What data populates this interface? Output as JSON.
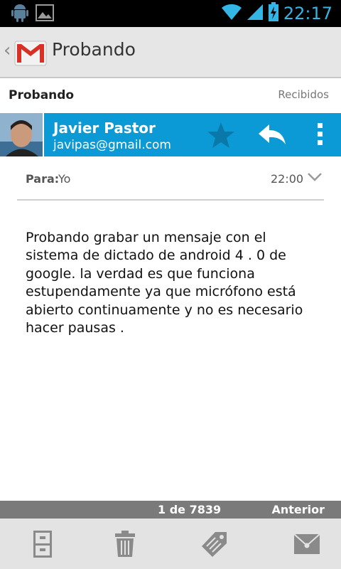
{
  "status_bar": {
    "left_icons": [
      "android-icon",
      "image-icon"
    ],
    "right_icons": [
      "wifi-icon",
      "signal-icon",
      "battery-charging-icon"
    ],
    "time": "22:17",
    "accent_color": "#33b5e5"
  },
  "action_bar": {
    "title": "Probando",
    "app_icon": "gmail-icon",
    "up_glyph": "‹"
  },
  "message": {
    "subject": "Probando",
    "folder": "Recibidos",
    "sender": {
      "name": "Javier Pastor",
      "email": "javipas@gmail.com",
      "header_color": "#0c9ad6"
    },
    "to_label": "Para:",
    "to_value": "Yo",
    "time": "22:00",
    "body": "Probando grabar un mensaje con el sistema de dictado de android 4 . 0 de google. la verdad es que funciona estupendamente ya que micrófono está abierto continuamente y no es necesario hacer pausas ."
  },
  "pager": {
    "count": "1 de 7839",
    "previous": "Anterior"
  },
  "bottom_bar": {
    "buttons": [
      "archive-icon",
      "delete-icon",
      "label-icon",
      "mark-unread-icon"
    ]
  }
}
